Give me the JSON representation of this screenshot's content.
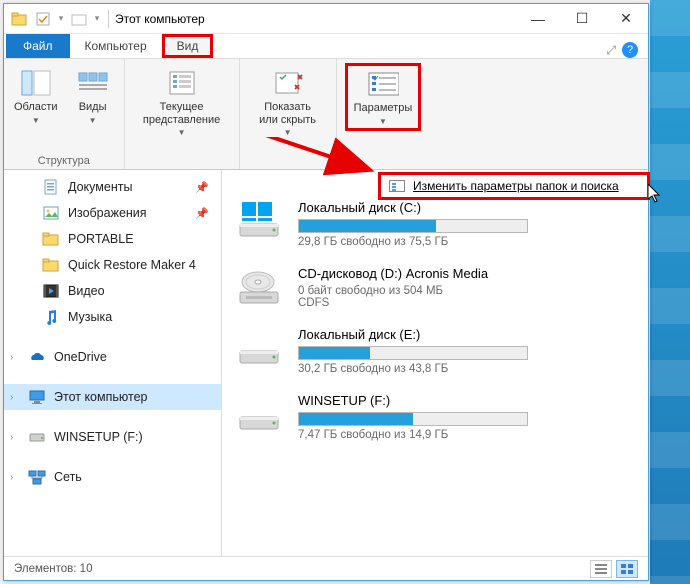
{
  "window": {
    "title": "Этот компьютер"
  },
  "tabs": {
    "file": "Файл",
    "computer": "Компьютер",
    "view": "Вид"
  },
  "ribbon": {
    "panes": {
      "label": "Области",
      "group": "Структура"
    },
    "views": {
      "label": "Виды"
    },
    "current": {
      "label": "Текущее\nпредставление"
    },
    "showhide": {
      "label": "Показать\nили скрыть"
    },
    "options": {
      "label": "Параметры"
    }
  },
  "dropdown": {
    "text": "Изменить параметры папок и поиска"
  },
  "sidebar": {
    "items": [
      {
        "label": "Документы",
        "icon": "docs",
        "pinned": true
      },
      {
        "label": "Изображения",
        "icon": "images",
        "pinned": true
      },
      {
        "label": "PORTABLE",
        "icon": "folder-y"
      },
      {
        "label": "Quick Restore Maker 4",
        "icon": "folder-y"
      },
      {
        "label": "Видео",
        "icon": "video"
      },
      {
        "label": "Музыка",
        "icon": "music"
      }
    ],
    "onedrive": "OneDrive",
    "thispc": "Этот компьютер",
    "winsetup": "WINSETUP (F:)",
    "network": "Сеть"
  },
  "drives": [
    {
      "name": "Локальный диск (C:)",
      "sub": "29,8 ГБ свободно из 75,5 ГБ",
      "fill": 60,
      "type": "hdd",
      "win": true
    },
    {
      "name": "CD-дисковод (D:) Acronis Media",
      "sub": "0 байт свободно из 504 МБ",
      "sub2": "CDFS",
      "type": "cd"
    },
    {
      "name": "Локальный диск (E:)",
      "sub": "30,2 ГБ свободно из 43,8 ГБ",
      "fill": 31,
      "type": "hdd"
    },
    {
      "name": "WINSETUP (F:)",
      "sub": "7,47 ГБ свободно из 14,9 ГБ",
      "fill": 50,
      "type": "hdd"
    }
  ],
  "status": {
    "text": "Элементов: 10"
  }
}
